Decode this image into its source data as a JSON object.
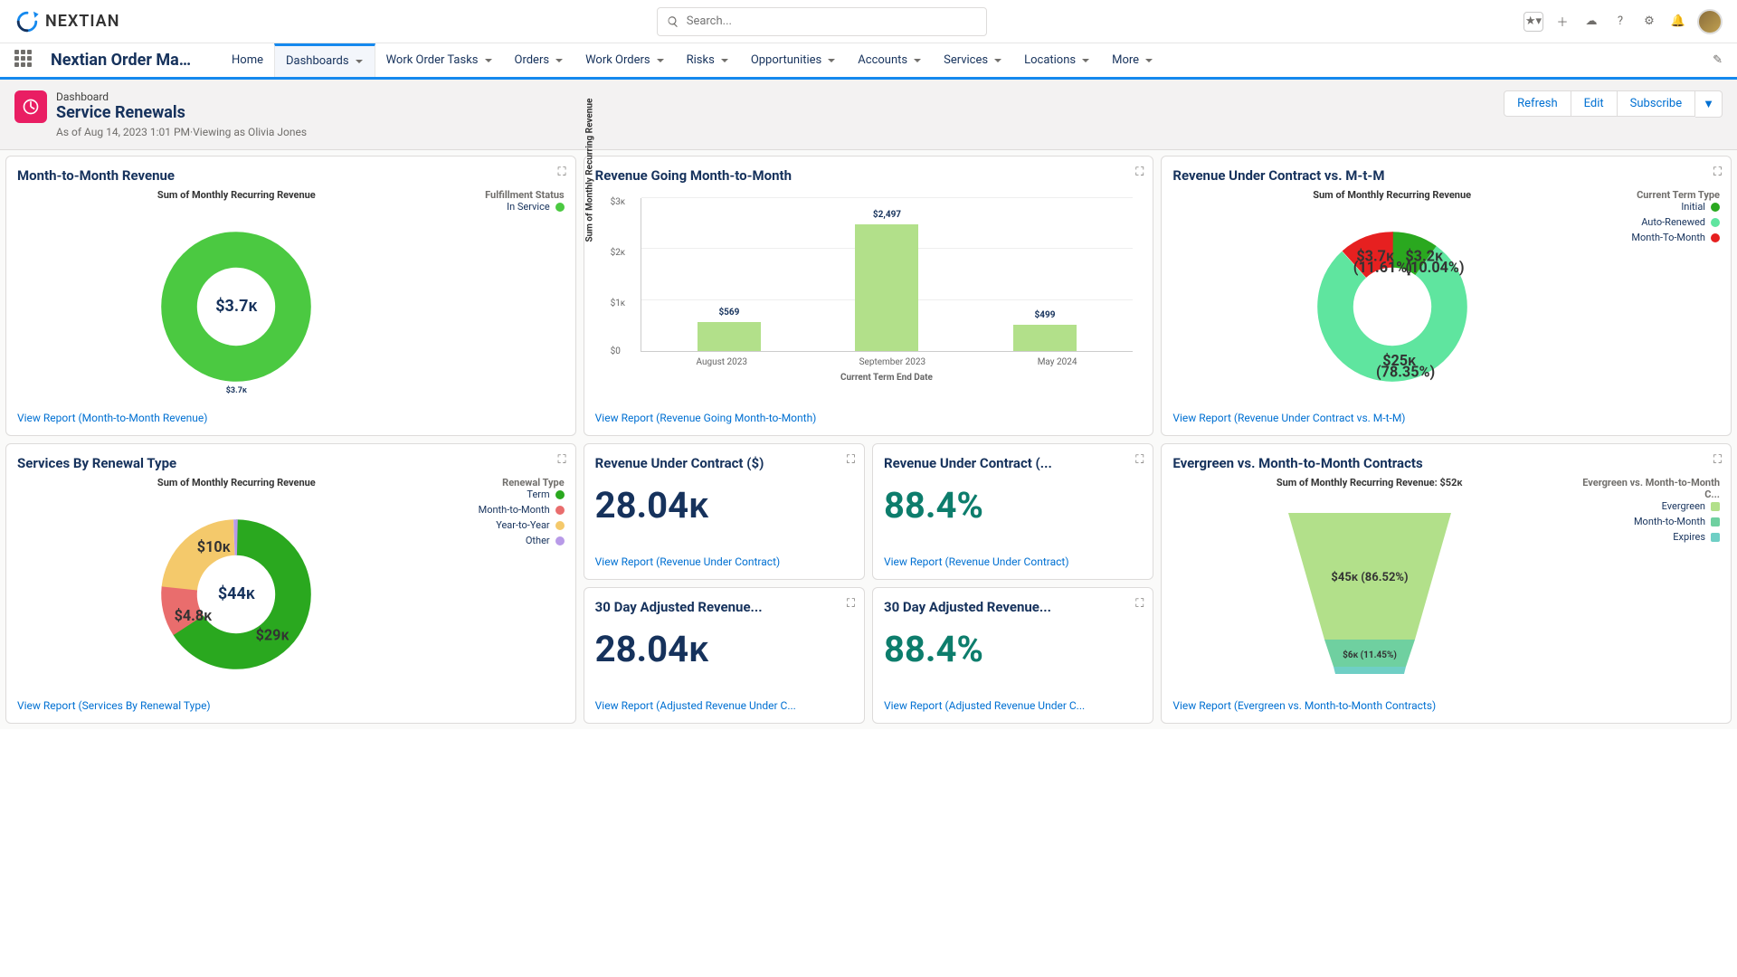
{
  "brand": "NEXTIAN",
  "search_placeholder": "Search...",
  "app_title": "Nextian Order Man...",
  "nav": {
    "home": "Home",
    "dashboards": "Dashboards",
    "work_order_tasks": "Work Order Tasks",
    "orders": "Orders",
    "work_orders": "Work Orders",
    "risks": "Risks",
    "opportunities": "Opportunities",
    "accounts": "Accounts",
    "services": "Services",
    "locations": "Locations",
    "more": "More"
  },
  "page": {
    "type": "Dashboard",
    "title": "Service Renewals",
    "meta": "As of Aug 14, 2023 1:01 PM·Viewing as Olivia Jones",
    "refresh": "Refresh",
    "edit": "Edit",
    "subscribe": "Subscribe"
  },
  "cards": {
    "mtm_rev": {
      "title": "Month-to-Month Revenue",
      "subtitle": "Sum of Monthly Recurring Revenue",
      "legend_title": "Fulfillment Status",
      "legend_items": [
        {
          "label": "In Service",
          "color": "#4bc941"
        }
      ],
      "center": "$3.7ᴋ",
      "slice_label": "$3.7ᴋ",
      "link": "View Report (Month-to-Month Revenue)"
    },
    "rev_going": {
      "title": "Revenue Going Month-to-Month",
      "ylabel": "Sum of Monthly Recurring Revenue",
      "xlabel": "Current Term End Date",
      "link": "View Report (Revenue Going Month-to-Month)"
    },
    "rev_contract_mtm": {
      "title": "Revenue Under Contract vs. M-t-M",
      "subtitle": "Sum of Monthly Recurring Revenue",
      "legend_title": "Current Term Type",
      "legend_items": [
        {
          "label": "Initial",
          "color": "#2aa81f"
        },
        {
          "label": "Auto-Renewed",
          "color": "#5fe59f"
        },
        {
          "label": "Month-To-Month",
          "color": "#e62020"
        }
      ],
      "link": "View Report (Revenue Under Contract vs. M-t-M)"
    },
    "svc_renewal": {
      "title": "Services By Renewal Type",
      "subtitle": "Sum of Monthly Recurring Revenue",
      "legend_title": "Renewal Type",
      "legend_items": [
        {
          "label": "Term",
          "color": "#2aa81f"
        },
        {
          "label": "Month-to-Month",
          "color": "#e96d6d"
        },
        {
          "label": "Year-to-Year",
          "color": "#f4c96b"
        },
        {
          "label": "Other",
          "color": "#b89ae8"
        }
      ],
      "center": "$44ᴋ",
      "link": "View Report (Services By Renewal Type)"
    },
    "ruc_dollar": {
      "title": "Revenue Under Contract ($)",
      "value": "28.04ᴋ",
      "link": "View Report (Revenue Under Contract)"
    },
    "ruc_pct": {
      "title": "Revenue Under Contract (...",
      "value": "88.4%",
      "link": "View Report (Revenue Under Contract)"
    },
    "adj_dollar": {
      "title": "30 Day Adjusted Revenue...",
      "value": "28.04ᴋ",
      "link": "View Report (Adjusted Revenue Under C..."
    },
    "adj_pct": {
      "title": "30 Day Adjusted Revenue...",
      "value": "88.4%",
      "link": "View Report (Adjusted Revenue Under C..."
    },
    "evergreen": {
      "title": "Evergreen vs. Month-to-Month Contracts",
      "subtitle": "Sum of Monthly Recurring Revenue: $52ᴋ",
      "legend_title": "Evergreen vs. Month-to-Month C...",
      "legend_items": [
        {
          "label": "Evergreen",
          "color": "#b2e08a"
        },
        {
          "label": "Month-to-Month",
          "color": "#6fd0a0"
        },
        {
          "label": "Expires",
          "color": "#6fcfc5"
        }
      ],
      "link": "View Report (Evergreen vs. Month-to-Month Contracts)"
    }
  },
  "chart_data": {
    "mtm_rev": {
      "type": "pie",
      "series": [
        {
          "name": "In Service",
          "value": 3.7,
          "label": "$3.7ᴋ"
        }
      ],
      "total_label": "$3.7ᴋ"
    },
    "rev_going": {
      "type": "bar",
      "categories": [
        "August 2023",
        "September 2023",
        "May 2024"
      ],
      "values": [
        569,
        2497,
        499
      ],
      "value_labels": [
        "$569",
        "$2,497",
        "$499"
      ],
      "ylabel": "Sum of Monthly Recurring Revenue",
      "xlabel": "Current Term End Date",
      "yticks": [
        "$0",
        "$1ᴋ",
        "$2ᴋ",
        "$3ᴋ"
      ],
      "ymax": 3000
    },
    "rev_contract_mtm": {
      "type": "pie",
      "series": [
        {
          "name": "Initial",
          "value": 3.2,
          "pct": "10.04%",
          "label": "$3.2ᴋ",
          "color": "#2aa81f"
        },
        {
          "name": "Auto-Renewed",
          "value": 25,
          "pct": "78.35%",
          "label": "$25ᴋ",
          "color": "#5fe59f"
        },
        {
          "name": "Month-To-Month",
          "value": 3.7,
          "pct": "11.61%",
          "label": "$3.7ᴋ",
          "color": "#e62020"
        }
      ]
    },
    "svc_renewal": {
      "type": "pie",
      "series": [
        {
          "name": "Term",
          "value": 29,
          "label": "$29ᴋ",
          "color": "#2aa81f"
        },
        {
          "name": "Month-to-Month",
          "value": 4.8,
          "label": "$4.8ᴋ",
          "color": "#e96d6d"
        },
        {
          "name": "Year-to-Year",
          "value": 10,
          "label": "$10ᴋ",
          "color": "#f4c96b"
        },
        {
          "name": "Other",
          "value": 0.2,
          "label": "",
          "color": "#b89ae8"
        }
      ],
      "total_label": "$44ᴋ"
    },
    "evergreen": {
      "type": "funnel",
      "series": [
        {
          "name": "Evergreen",
          "value": 45,
          "pct": "86.52%",
          "label": "$45ᴋ (86.52%)",
          "color": "#b2e08a"
        },
        {
          "name": "Month-to-Month",
          "value": 6,
          "pct": "11.45%",
          "label": "$6ᴋ (11.45%)",
          "color": "#6fd0a0"
        },
        {
          "name": "Expires",
          "value": 1,
          "pct": "2.03%",
          "label": "",
          "color": "#6fcfc5"
        }
      ],
      "total_label": "$52ᴋ"
    }
  }
}
